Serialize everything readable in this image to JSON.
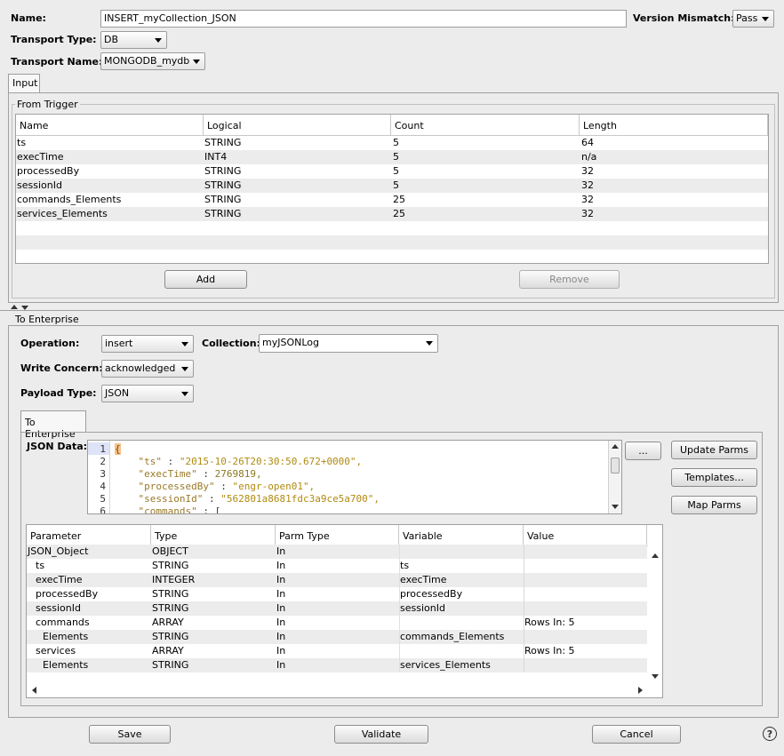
{
  "header": {
    "name_label": "Name:",
    "name_value": "INSERT_myCollection_JSON",
    "version_mismatch_label": "Version Mismatch:",
    "version_mismatch_value": "Pass",
    "transport_type_label": "Transport Type:",
    "transport_type_value": "DB",
    "transport_name_label": "Transport Name:",
    "transport_name_value": "MONGODB_mydb"
  },
  "input_tab": {
    "label": "Input"
  },
  "from_trigger": {
    "title": "From Trigger",
    "columns": [
      "Name",
      "Logical",
      "Count",
      "Length"
    ],
    "rows": [
      [
        "ts",
        "STRING",
        "5",
        "64"
      ],
      [
        "execTime",
        "INT4",
        "5",
        "n/a"
      ],
      [
        "processedBy",
        "STRING",
        "5",
        "32"
      ],
      [
        "sessionId",
        "STRING",
        "5",
        "32"
      ],
      [
        "commands_Elements",
        "STRING",
        "25",
        "32"
      ],
      [
        "services_Elements",
        "STRING",
        "25",
        "32"
      ]
    ],
    "add_label": "Add",
    "remove_label": "Remove"
  },
  "to_enterprise": {
    "title": "To Enterprise",
    "operation_label": "Operation:",
    "operation_value": "insert",
    "collection_label": "Collection:",
    "collection_value": "myJSONLog",
    "write_concern_label": "Write Concern:",
    "write_concern_value": "acknowledged",
    "payload_type_label": "Payload Type:",
    "payload_type_value": "JSON",
    "inner_tab_label": "To Enterprise",
    "json_data_label": "JSON Data:",
    "ellipsis_label": "...",
    "update_parms_label": "Update Parms",
    "templates_label": "Templates...",
    "map_parms_label": "Map Parms",
    "code_lines": [
      {
        "n": "1",
        "indent": "",
        "key": "",
        "sep": "",
        "value": "{"
      },
      {
        "n": "2",
        "indent": "    ",
        "key": "\"ts\"",
        "sep": " : ",
        "value": "\"2015-10-26T20:30:50.672+0000\","
      },
      {
        "n": "3",
        "indent": "    ",
        "key": "\"execTime\"",
        "sep": " : ",
        "value": "2769819,"
      },
      {
        "n": "4",
        "indent": "    ",
        "key": "\"processedBy\"",
        "sep": " : ",
        "value": "\"engr-open01\","
      },
      {
        "n": "5",
        "indent": "    ",
        "key": "\"sessionId\"",
        "sep": " : ",
        "value": "\"562801a8681fdc3a9ce5a700\","
      },
      {
        "n": "6",
        "indent": "    ",
        "key": "\"commands\"",
        "sep": " : ",
        "value": "["
      }
    ],
    "param_columns": [
      "Parameter",
      "Type",
      "Parm Type",
      "Variable",
      "Value"
    ],
    "param_rows": [
      [
        "JSON_Object",
        "OBJECT",
        "In",
        "",
        ""
      ],
      [
        "ts",
        "STRING",
        "In",
        "ts",
        ""
      ],
      [
        "execTime",
        "INTEGER",
        "In",
        "execTime",
        ""
      ],
      [
        "processedBy",
        "STRING",
        "In",
        "processedBy",
        ""
      ],
      [
        "sessionId",
        "STRING",
        "In",
        "sessionId",
        ""
      ],
      [
        "commands",
        "ARRAY",
        "In",
        "",
        "Rows In: 5"
      ],
      [
        "Elements",
        "STRING",
        "In",
        "commands_Elements",
        ""
      ],
      [
        "services",
        "ARRAY",
        "In",
        "",
        "Rows In: 5"
      ],
      [
        "Elements",
        "STRING",
        "In",
        "services_Elements",
        ""
      ]
    ]
  },
  "footer": {
    "save_label": "Save",
    "validate_label": "Validate",
    "cancel_label": "Cancel",
    "help_label": "?"
  },
  "colors": {
    "json_key": "#7a6b2f",
    "json_value": "#8b7a1f",
    "json_string_value": "#b8860b",
    "line_highlight": "#dfe3f7"
  }
}
